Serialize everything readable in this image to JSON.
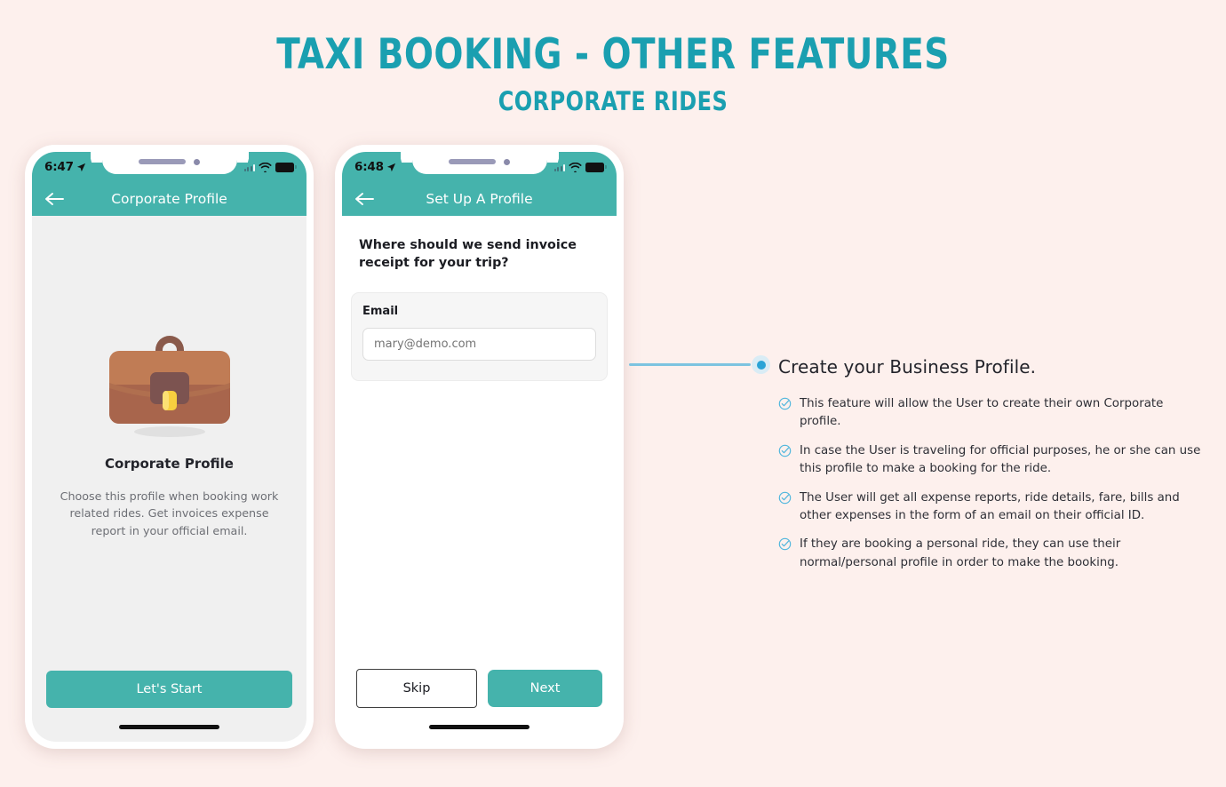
{
  "header": {
    "title": "TAXI BOOKING - OTHER FEATURES",
    "subtitle": "CORPORATE RIDES"
  },
  "colors": {
    "background": "#fdf0ed",
    "teal": "#45b3ac",
    "title_teal": "#1a9fb0",
    "connector_blue": "#7cc3e0",
    "dot_blue": "#2aa3d6"
  },
  "phone_1": {
    "status": {
      "time": "6:47",
      "location_icon": "location-arrow-icon",
      "signal_icon": "signal-icon",
      "wifi_icon": "wifi-icon",
      "battery_icon": "battery-icon"
    },
    "nav": {
      "back_icon": "back-arrow-icon",
      "title": "Corporate Profile"
    },
    "illustration_icon": "briefcase-illustration",
    "caption": "Corporate Profile",
    "description": "Choose this profile when booking work related rides. Get invoices expense report in your official email.",
    "primary_button": "Let's Start"
  },
  "phone_2": {
    "status": {
      "time": "6:48",
      "location_icon": "location-arrow-icon",
      "signal_icon": "signal-icon",
      "wifi_icon": "wifi-icon",
      "battery_icon": "battery-icon"
    },
    "nav": {
      "back_icon": "back-arrow-icon",
      "title": "Set Up A Profile"
    },
    "question": "Where should we send invoice receipt for your trip?",
    "email_label": "Email",
    "email_placeholder": "mary@demo.com",
    "email_value": "",
    "skip_button": "Skip",
    "next_button": "Next"
  },
  "annotation": {
    "title": "Create your Business Profile.",
    "bullet_icon": "check-circle-icon",
    "bullets": [
      {
        "text": "This feature will allow the User to create their own Corporate profile."
      },
      {
        "text": "In case the User is traveling for official purposes, he or she can use this profile to make a booking for the ride."
      },
      {
        "text": "The User will get all expense reports, ride details, fare, bills and other expenses in the form of an email on their official ID."
      },
      {
        "text": "If they are booking a personal ride, they can use their normal/personal profile in order to make the booking."
      }
    ]
  }
}
